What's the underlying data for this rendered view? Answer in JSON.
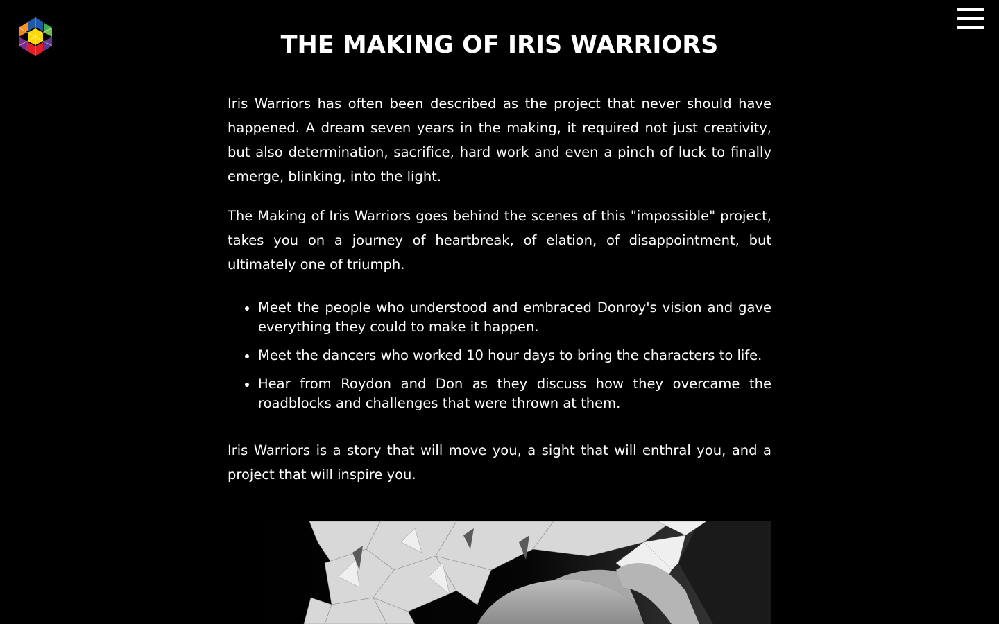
{
  "page": {
    "title": "THE MAKING OF IRIS WARRIORS",
    "background_color": "#000000",
    "text_color": "#ffffff"
  },
  "logo": {
    "icon": "hexagon-cluster-logo-icon",
    "colors": [
      "#1e5aa8",
      "#3fae49",
      "#ffd700",
      "#f58220",
      "#7b2d8e",
      "#e31e24",
      "#5a3a8e"
    ]
  },
  "menu": {
    "icon": "hamburger-menu-icon"
  },
  "content": {
    "paragraphs": [
      "Iris Warriors has often been described as the project that never should have happened. A dream seven years in the making, it required not just creativity, but also determination, sacrifice, hard work and even a pinch of luck to finally emerge, blinking, into the light.",
      "The Making of Iris Warriors goes behind the scenes of this \"impossible\" project, takes you on a journey of heartbreak, of elation, of disappointment, but ultimately one of triumph."
    ],
    "bullets": [
      "Meet the people who understood and embraced Donroy's vision and gave everything they could to make it happen.",
      "Meet the dancers who worked 10 hour days to bring the characters to life.",
      "Hear from Roydon and Don as they discuss how they overcame the roadblocks and challenges that were thrown at them."
    ],
    "closing": "Iris Warriors is a story that will move you, a sight that will enthral you, and a project that will inspire you."
  },
  "hero_image": {
    "icon": "costumed-dancer-photo"
  }
}
